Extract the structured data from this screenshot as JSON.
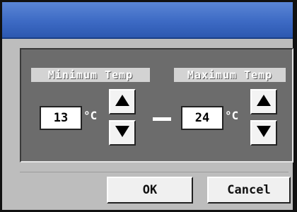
{
  "dialog": {
    "minimum": {
      "label": "Minimum Temp",
      "value": "13",
      "unit": "°C"
    },
    "maximum": {
      "label": "Maximum Temp",
      "value": "24",
      "unit": "°C"
    },
    "arrows": {
      "up_icon": "triangle-up-icon",
      "down_icon": "triangle-down-icon"
    },
    "buttons": {
      "ok_label": "OK",
      "cancel_label": "Cancel"
    },
    "colors": {
      "titlebar": "#3d6ac4",
      "panel": "#6c6c6c",
      "window_bg": "#bdbdbd"
    }
  }
}
